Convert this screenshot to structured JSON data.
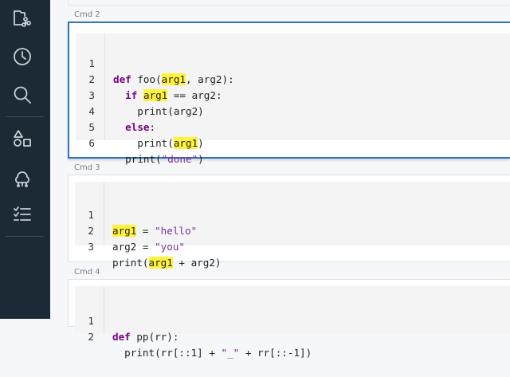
{
  "sidebar": {
    "icons": [
      "workspace-icon",
      "recents-icon",
      "search-icon",
      "shapes-icon",
      "cluster-icon",
      "jobs-icon"
    ]
  },
  "cells": [
    {
      "label": "Cmd 2",
      "lines": [
        {
          "num": "1",
          "code": "def foo(arg1, arg2):"
        },
        {
          "num": "2",
          "code": "  if arg1 == arg2:"
        },
        {
          "num": "3",
          "code": "    print(arg2)"
        },
        {
          "num": "4",
          "code": "  else:"
        },
        {
          "num": "5",
          "code": "    print(arg1)"
        },
        {
          "num": "6",
          "code": "  print(\"done\")"
        }
      ]
    },
    {
      "label": "Cmd 3",
      "lines": [
        {
          "num": "1",
          "code": "arg1 = \"hello\""
        },
        {
          "num": "2",
          "code": "arg2 = \"you\""
        },
        {
          "num": "3",
          "code": "print(arg1 + arg2)"
        }
      ]
    },
    {
      "label": "Cmd 4",
      "lines": [
        {
          "num": "1",
          "code": "def pp(rr):"
        },
        {
          "num": "2",
          "code": "  print(rr[::1] + \"_\" + rr[::-1])"
        }
      ]
    }
  ],
  "colors": {
    "sidebar": "#1b2a35",
    "active_border": "#2f74c0",
    "highlight": "#fff23a",
    "keyword": "#770088",
    "string": "#7a2fa2"
  }
}
